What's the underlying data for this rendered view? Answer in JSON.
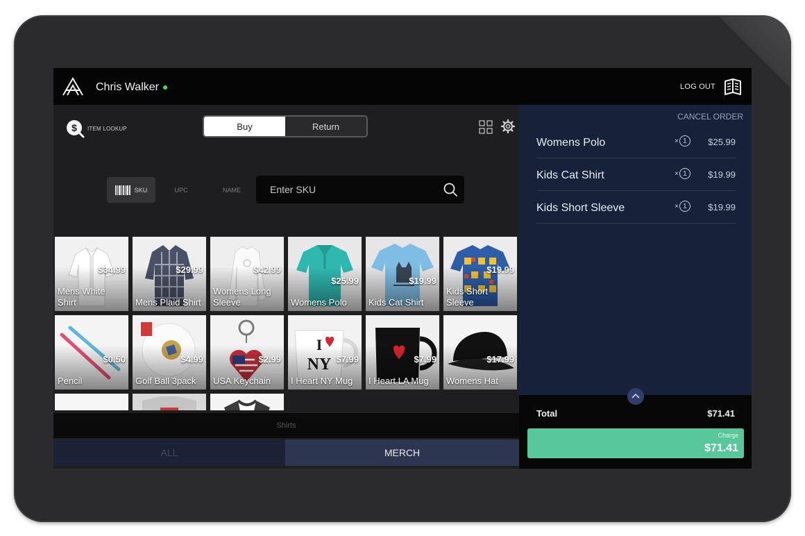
{
  "header": {
    "user_name": "Chris Walker",
    "logout_label": "LOG OUT",
    "status_color": "#3ddc6b"
  },
  "toolbar": {
    "item_lookup_label": "ITEM LOOKUP",
    "buy_label": "Buy",
    "return_label": "Return",
    "active_mode": "Buy"
  },
  "search": {
    "modes": [
      "SKU",
      "UPC",
      "NAME"
    ],
    "active_mode": "SKU",
    "placeholder": "Enter SKU",
    "value": ""
  },
  "products": [
    {
      "name": "Mens White Shirt",
      "price": "$34.99",
      "art": "white-shirt"
    },
    {
      "name": "Mens Plaid Shirt",
      "price": "$29.99",
      "art": "plaid-shirt"
    },
    {
      "name": "Womens Long Sleeve",
      "price": "$42.99",
      "art": "long-sleeve"
    },
    {
      "name": "Womens Polo",
      "price": "$25.99",
      "art": "polo"
    },
    {
      "name": "Kids Cat Shirt",
      "price": "$19.99",
      "art": "cat-shirt"
    },
    {
      "name": "Kids Short Sleeve",
      "price": "$19.99",
      "art": "short-sleeve"
    },
    {
      "name": "Pencil",
      "price": "$0.50",
      "art": "pencil"
    },
    {
      "name": "Golf Ball 3pack",
      "price": "$4.99",
      "art": "golf-ball"
    },
    {
      "name": "USA Keychain",
      "price": "$2.99",
      "art": "keychain"
    },
    {
      "name": "I Heart NY Mug",
      "price": "$7.99",
      "art": "ny-mug"
    },
    {
      "name": "I Heart LA Mug",
      "price": "$7.99",
      "art": "la-mug"
    },
    {
      "name": "Womens Hat",
      "price": "$17.99",
      "art": "hat"
    },
    {
      "name": "",
      "price": "",
      "art": "partial-white"
    },
    {
      "name": "",
      "price": "",
      "art": "partial-grey"
    },
    {
      "name": "",
      "price": "",
      "art": "partial-raglan"
    }
  ],
  "category_strip": {
    "label": "Shirts"
  },
  "category_tabs": {
    "all_label": "ALL",
    "merch_label": "MERCH",
    "active": "MERCH"
  },
  "order": {
    "cancel_label": "CANCEL ORDER",
    "items": [
      {
        "name": "Womens Polo",
        "qty": "1",
        "qty_prefix": "×",
        "price": "$25.99"
      },
      {
        "name": "Kids Cat Shirt",
        "qty": "1",
        "qty_prefix": "×",
        "price": "$19.99"
      },
      {
        "name": "Kids Short Sleeve",
        "qty": "1",
        "qty_prefix": "×",
        "price": "$19.99"
      }
    ],
    "total_label": "Total",
    "total_value": "$71.41",
    "charge_label": "Charge",
    "charge_amount": "$71.41",
    "charge_color": "#58c89c"
  }
}
